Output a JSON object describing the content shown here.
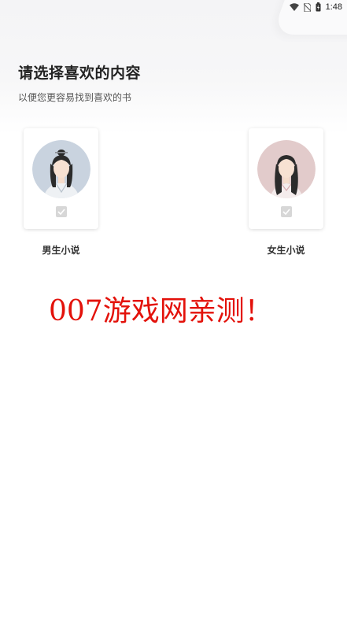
{
  "status_bar": {
    "time": "1:48",
    "icons": [
      "wifi-icon",
      "no-sim-icon",
      "battery-icon"
    ]
  },
  "header": {
    "title": "请选择喜欢的内容",
    "subtitle": "以便您更容易找到喜欢的书"
  },
  "options": [
    {
      "label": "男生小说",
      "avatar": "male-avatar-icon",
      "checked": false
    },
    {
      "label": "女生小说",
      "avatar": "female-avatar-icon",
      "checked": false
    }
  ],
  "watermark": {
    "text": "007游戏网亲测！",
    "color": "#e3120b"
  }
}
